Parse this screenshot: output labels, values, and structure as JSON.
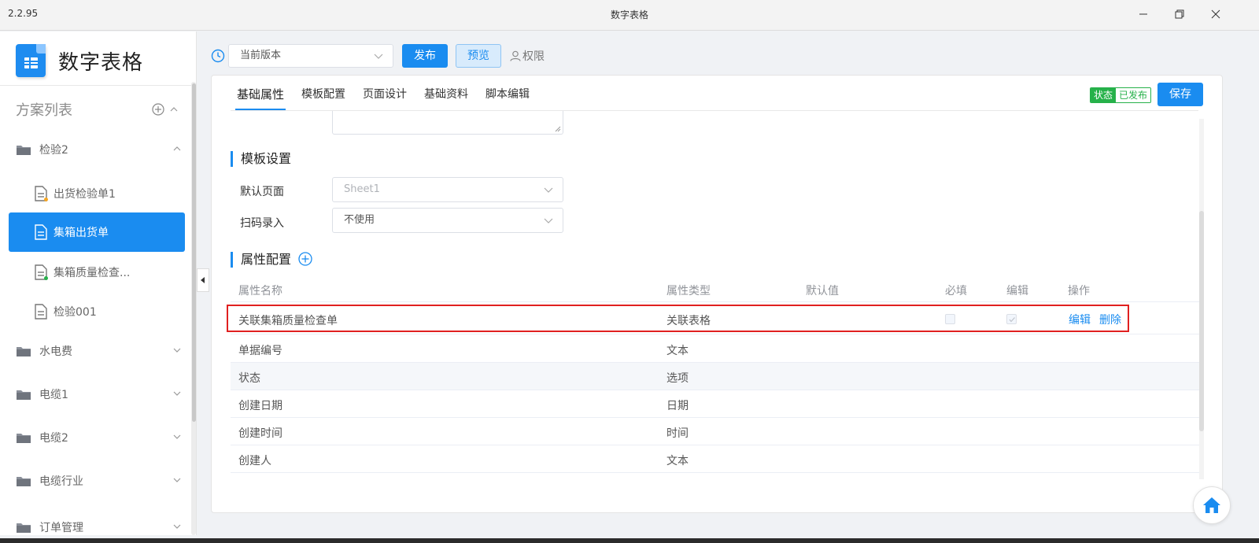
{
  "window": {
    "version": "2.2.95",
    "title": "数字表格"
  },
  "brand": {
    "name": "数字表格"
  },
  "sidebar": {
    "plan_list_title": "方案列表",
    "folders": [
      {
        "label": "检验2",
        "expanded": true
      },
      {
        "label": "水电费",
        "expanded": false
      },
      {
        "label": "电缆1",
        "expanded": false
      },
      {
        "label": "电缆2",
        "expanded": false
      },
      {
        "label": "电缆行业",
        "expanded": false
      },
      {
        "label": "订单管理",
        "expanded": false
      }
    ],
    "files": [
      {
        "label": "出货检验单1",
        "dot_color": "#f5a623"
      },
      {
        "label": "集箱出货单",
        "active": true
      },
      {
        "label": "集箱质量检查...",
        "dot_color": "#26b14a"
      },
      {
        "label": "检验001"
      }
    ]
  },
  "toolbar": {
    "version_select": "当前版本",
    "publish_label": "发布",
    "preview_label": "预览",
    "permission_label": "权限"
  },
  "tabs": [
    {
      "label": "基础属性",
      "active": true
    },
    {
      "label": "模板配置"
    },
    {
      "label": "页面设计"
    },
    {
      "label": "基础资料"
    },
    {
      "label": "脚本编辑"
    }
  ],
  "status_badge": {
    "key": "状态",
    "value": "已发布"
  },
  "save_label": "保存",
  "template_settings": {
    "title": "模板设置",
    "default_page_label": "默认页面",
    "default_page_placeholder": "Sheet1",
    "scan_input_label": "扫码录入",
    "scan_input_value": "不使用"
  },
  "attribute_config": {
    "title": "属性配置",
    "columns": [
      "属性名称",
      "属性类型",
      "默认值",
      "必填",
      "编辑",
      "操作"
    ],
    "rows": [
      {
        "name": "关联集箱质量检查单",
        "type": "关联表格",
        "default": "",
        "required": false,
        "editable": true,
        "actions": [
          "编辑",
          "删除"
        ]
      },
      {
        "name": "单据编号",
        "type": "文本"
      },
      {
        "name": "状态",
        "type": "选项"
      },
      {
        "name": "创建日期",
        "type": "日期"
      },
      {
        "name": "创建时间",
        "type": "时间"
      },
      {
        "name": "创建人",
        "type": "文本"
      }
    ]
  },
  "colors": {
    "accent": "#1a8cf0",
    "success": "#26b14a",
    "highlight_border": "#e02020"
  }
}
